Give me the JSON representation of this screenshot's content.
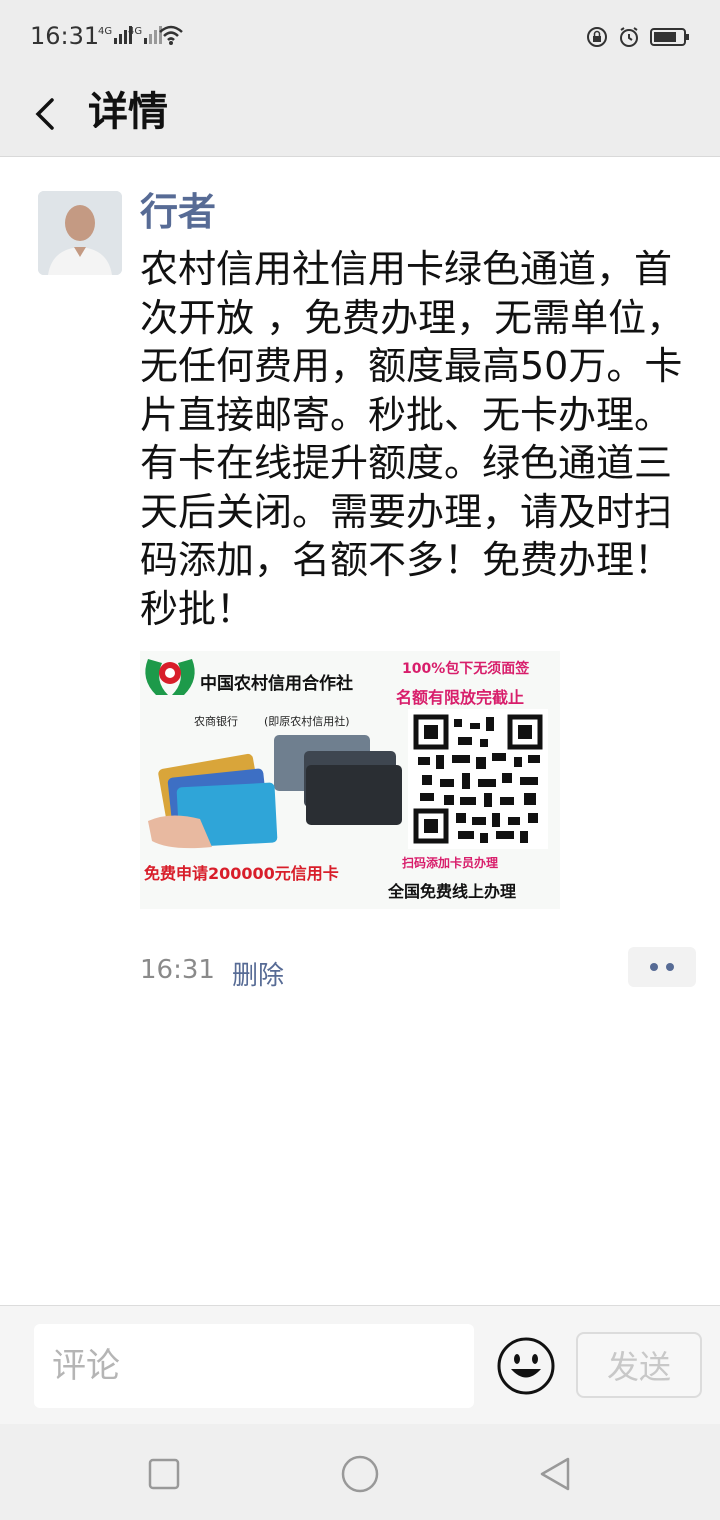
{
  "status": {
    "time": "16:31",
    "net1": "4G",
    "net2": "4G"
  },
  "nav": {
    "title": "详情"
  },
  "post": {
    "author": "行者",
    "text": "农村信用社信用卡绿色通道，首次开放 ，免费办理，无需单位，无任何费用，额度最高50万。卡片直接邮寄。秒批、无卡办理。有卡在线提升额度。绿色通道三天后关闭。需要办理，请及时扫码添加，名额不多！免费办理！秒批！",
    "time": "16:31",
    "delete_label": "删除",
    "image": {
      "bank_name": "中国农村信用合作社",
      "promo1": "100%包下无须面签",
      "promo2": "名额有限放完截止",
      "subtitle1": "农商银行",
      "subtitle2": "(即原农村信用社)",
      "scan_text": "扫码添加卡员办理",
      "apply_text": "免费申请200000元信用卡",
      "online_text": "全国免费线上办理"
    }
  },
  "comment": {
    "placeholder": "评论",
    "send_label": "发送"
  },
  "colors": {
    "link": "#576b95",
    "bar": "#ededed"
  }
}
